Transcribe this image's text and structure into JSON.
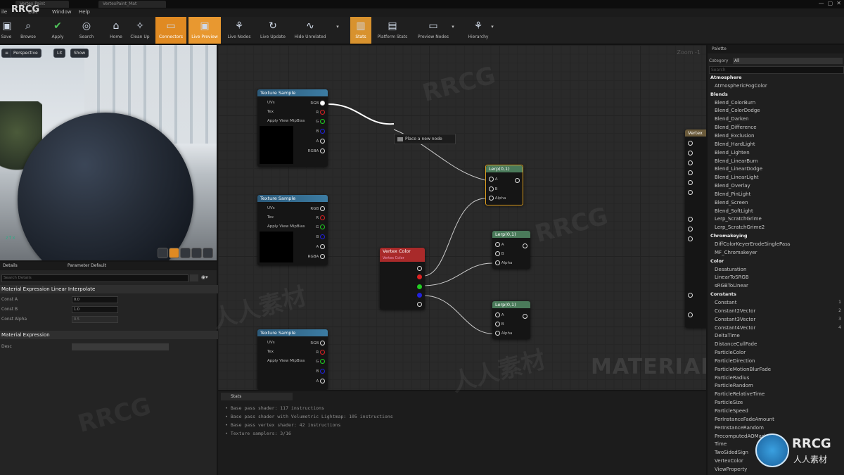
{
  "menubar": {
    "logo": "RRCG",
    "items": [
      "ile",
      "Edit",
      "Window",
      "Help"
    ],
    "tabs": [
      "Vertex Paint",
      "VertexPaint_Mat"
    ]
  },
  "toolbar": {
    "buttons": [
      {
        "label": "Save",
        "icon": "save-icon"
      },
      {
        "label": "Browse",
        "icon": "search-icon"
      },
      {
        "label": "Apply",
        "icon": "check-icon"
      },
      {
        "label": "Search",
        "icon": "binoculars-icon"
      },
      {
        "label": "Home",
        "icon": "home-icon"
      },
      {
        "label": "Clean Up",
        "icon": "broom-icon"
      },
      {
        "label": "Connectors",
        "icon": "connectors-icon"
      },
      {
        "label": "Live Preview",
        "icon": "live-preview-icon"
      },
      {
        "label": "Live Nodes",
        "icon": "live-nodes-icon"
      },
      {
        "label": "Live Update",
        "icon": "live-update-icon"
      },
      {
        "label": "Hide Unrelated",
        "icon": "hide-unrelated-icon"
      },
      {
        "label": "Stats",
        "icon": "stats-icon"
      },
      {
        "label": "Platform Stats",
        "icon": "platform-stats-icon"
      },
      {
        "label": "Preview Nodes",
        "icon": "preview-nodes-icon"
      },
      {
        "label": "Hierarchy",
        "icon": "hierarchy-icon"
      }
    ]
  },
  "viewport": {
    "perspective": "Perspective",
    "lit": "Lit",
    "show": "Show"
  },
  "details": {
    "tabs": [
      "Details",
      "Parameter Default"
    ],
    "search_placeholder": "Search Details",
    "section1": "Material Expression Linear Interpolate",
    "props": [
      {
        "label": "Const A",
        "value": "0.0"
      },
      {
        "label": "Const B",
        "value": "1.0"
      },
      {
        "label": "Const Alpha",
        "value": "0.5"
      }
    ],
    "section2": "Material Expression",
    "desc_label": "Desc"
  },
  "graph": {
    "zoom": "Zoom -1",
    "watermark": "MATERIAL",
    "place_node": "Place a new node",
    "texture_sample": {
      "title": "Texture Sample",
      "inputs": [
        "UVs",
        "Tex",
        "Apply View MipBias"
      ],
      "outputs": [
        "RGB",
        "R",
        "G",
        "B",
        "A",
        "RGBA"
      ]
    },
    "vertex_color": {
      "title": "Vertex Color",
      "subtitle": "Vertex Color"
    },
    "lerp1": {
      "title": "Lerp(0,1)",
      "pins": [
        "A",
        "B",
        "Alpha"
      ]
    },
    "lerp2": {
      "title": "Lerp(0,1)",
      "pins": [
        "A",
        "B",
        "Alpha"
      ]
    },
    "lerp3": {
      "title": "Lerp(0,1)",
      "pins": [
        "A",
        "B",
        "Alpha"
      ]
    },
    "result_title": "Vertex"
  },
  "stats": {
    "tab": "Stats",
    "lines": [
      "• Base pass shader: 117 instructions",
      "• Base pass shader with Volumetric Lightmap: 105 instructions",
      "• Base pass vertex shader: 42 instructions",
      "• Texture samplers: 3/16"
    ]
  },
  "palette": {
    "title": "Palette",
    "category_label": "Category",
    "category_value": "All",
    "search_placeholder": "Search",
    "entries": [
      {
        "t": "cat",
        "text": "Atmosphere"
      },
      {
        "t": "item",
        "text": "AtmosphericFogColor"
      },
      {
        "t": "cat",
        "text": "Blends"
      },
      {
        "t": "item",
        "text": "Blend_ColorBurn"
      },
      {
        "t": "item",
        "text": "Blend_ColorDodge"
      },
      {
        "t": "item",
        "text": "Blend_Darken"
      },
      {
        "t": "item",
        "text": "Blend_Difference"
      },
      {
        "t": "item",
        "text": "Blend_Exclusion"
      },
      {
        "t": "item",
        "text": "Blend_HardLight"
      },
      {
        "t": "item",
        "text": "Blend_Lighten"
      },
      {
        "t": "item",
        "text": "Blend_LinearBurn"
      },
      {
        "t": "item",
        "text": "Blend_LinearDodge"
      },
      {
        "t": "item",
        "text": "Blend_LinearLight"
      },
      {
        "t": "item",
        "text": "Blend_Overlay"
      },
      {
        "t": "item",
        "text": "Blend_PinLight"
      },
      {
        "t": "item",
        "text": "Blend_Screen"
      },
      {
        "t": "item",
        "text": "Blend_SoftLight"
      },
      {
        "t": "item",
        "text": "Lerp_ScratchGrime"
      },
      {
        "t": "item",
        "text": "Lerp_ScratchGrime2"
      },
      {
        "t": "cat",
        "text": "Chromakeying"
      },
      {
        "t": "item",
        "text": "DiffColorKeyerErodeSinglePass"
      },
      {
        "t": "item",
        "text": "MF_Chromakeyer"
      },
      {
        "t": "cat",
        "text": "Color"
      },
      {
        "t": "item",
        "text": "Desaturation"
      },
      {
        "t": "item",
        "text": "LinearToSRGB"
      },
      {
        "t": "item",
        "text": "sRGBToLinear"
      },
      {
        "t": "cat",
        "text": "Constants"
      },
      {
        "t": "item",
        "text": "Constant",
        "num": "1"
      },
      {
        "t": "item",
        "text": "Constant2Vector",
        "num": "2"
      },
      {
        "t": "item",
        "text": "Constant3Vector",
        "num": "3"
      },
      {
        "t": "item",
        "text": "Constant4Vector",
        "num": "4"
      },
      {
        "t": "item",
        "text": "DeltaTime"
      },
      {
        "t": "item",
        "text": "DistanceCullFade"
      },
      {
        "t": "item",
        "text": "ParticleColor"
      },
      {
        "t": "item",
        "text": "ParticleDirection"
      },
      {
        "t": "item",
        "text": "ParticleMotionBlurFade"
      },
      {
        "t": "item",
        "text": "ParticleRadius"
      },
      {
        "t": "item",
        "text": "ParticleRandom"
      },
      {
        "t": "item",
        "text": "ParticleRelativeTime"
      },
      {
        "t": "item",
        "text": "ParticleSize"
      },
      {
        "t": "item",
        "text": "ParticleSpeed"
      },
      {
        "t": "item",
        "text": "PerInstanceFadeAmount"
      },
      {
        "t": "item",
        "text": "PerInstanceRandom"
      },
      {
        "t": "item",
        "text": "PrecomputedAOMask"
      },
      {
        "t": "item",
        "text": "Time"
      },
      {
        "t": "item",
        "text": "TwoSidedSign"
      },
      {
        "t": "item",
        "text": "VertexColor"
      },
      {
        "t": "item",
        "text": "ViewProperty"
      }
    ]
  },
  "watermark": {
    "brand": "RRCG",
    "sub": "人人素材"
  }
}
